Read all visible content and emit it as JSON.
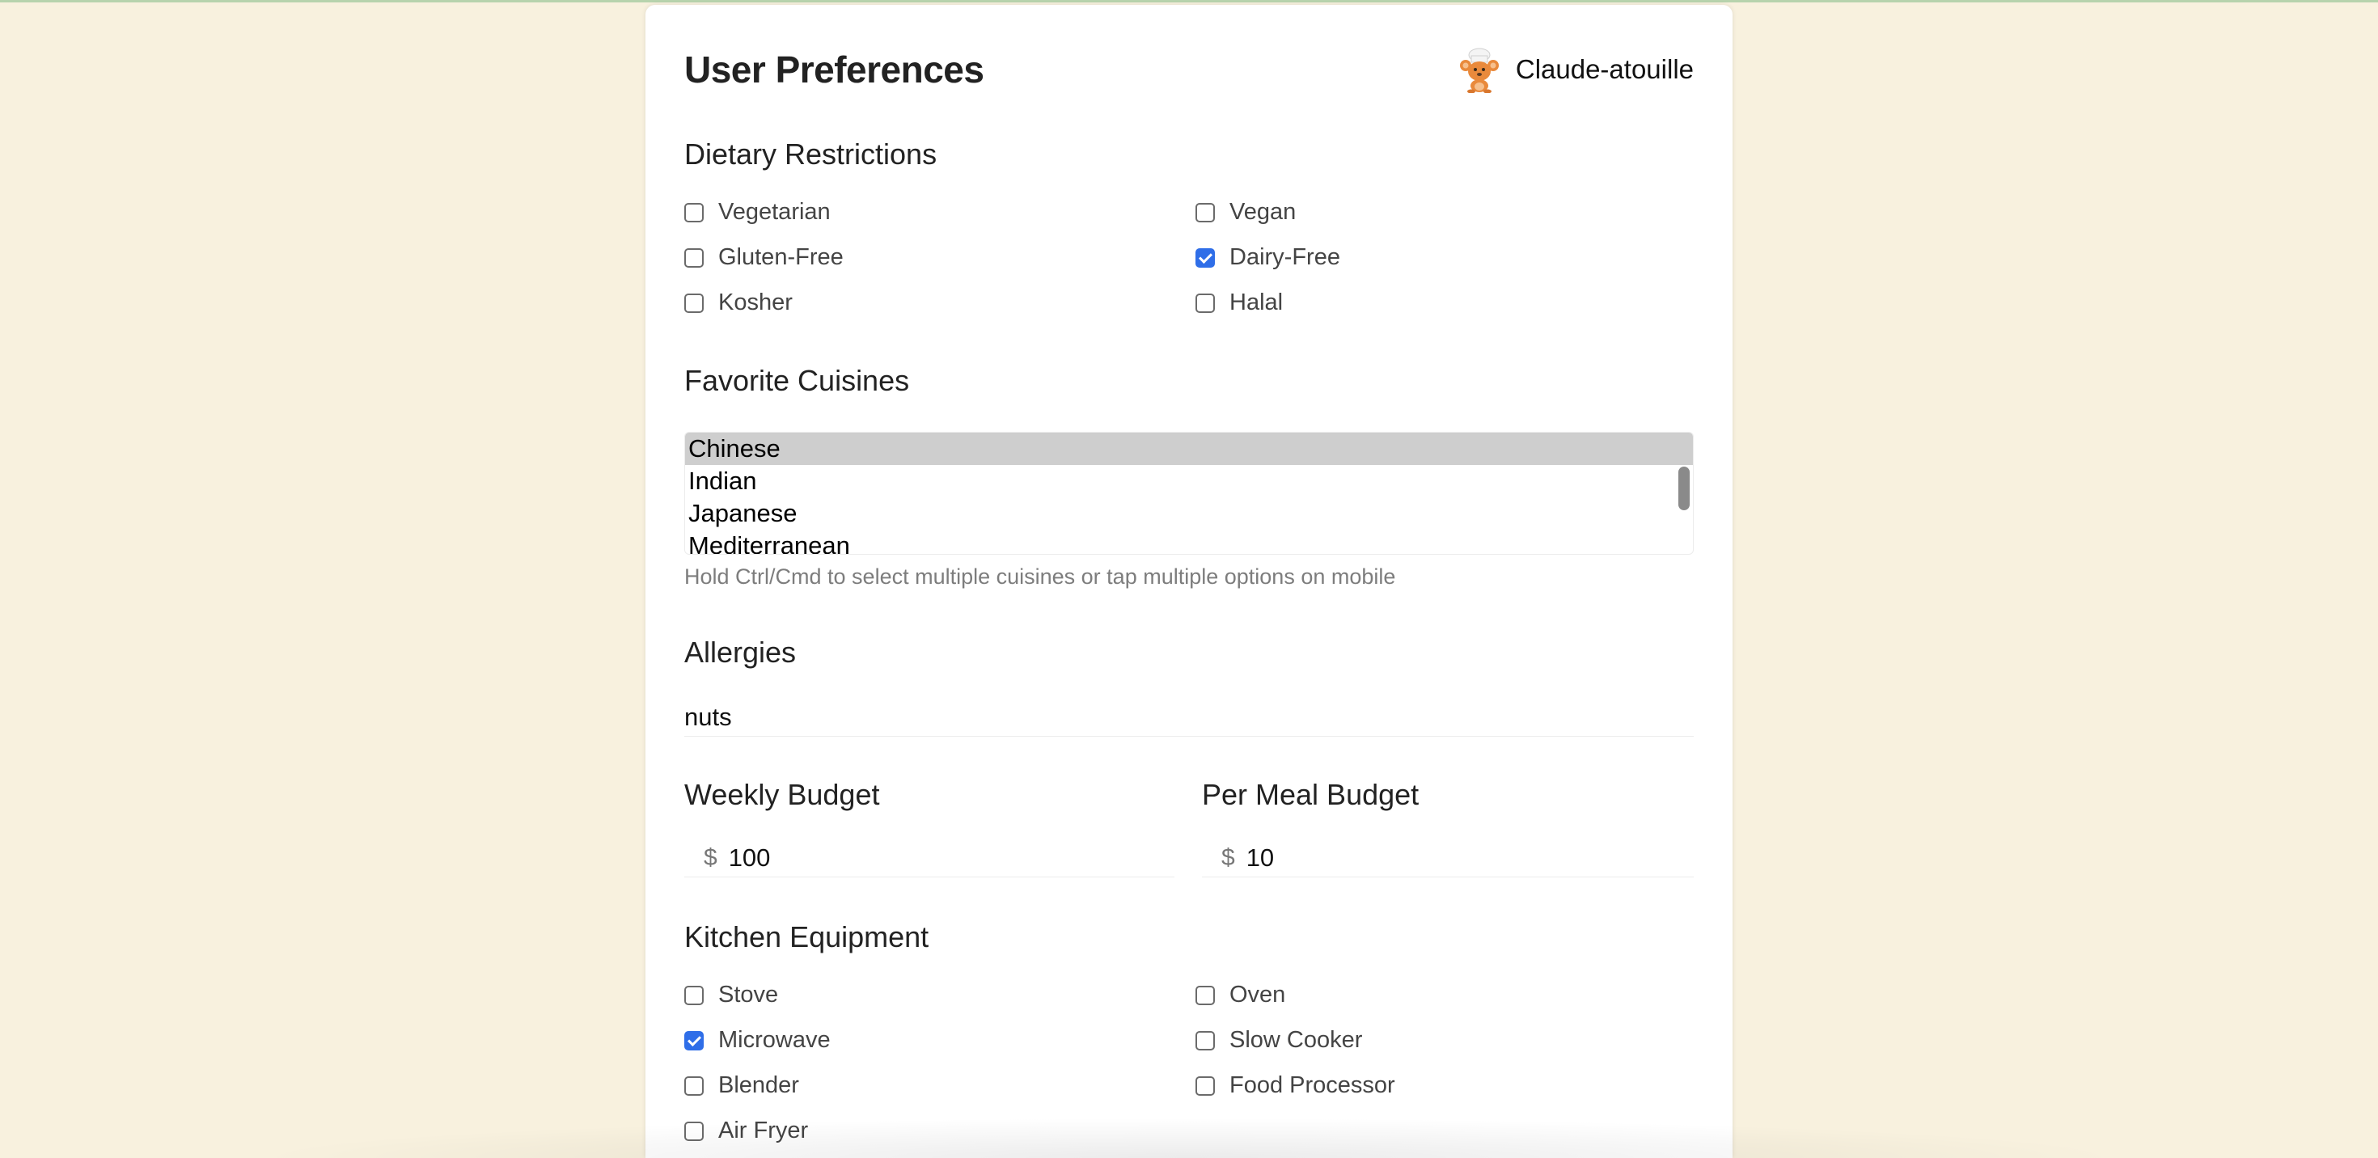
{
  "header": {
    "title": "User Preferences",
    "user_name": "Claude-atouille",
    "avatar_icon": "chef-mouse-avatar"
  },
  "dietary": {
    "title": "Dietary Restrictions",
    "options": [
      {
        "label": "Vegetarian",
        "checked": false
      },
      {
        "label": "Vegan",
        "checked": false
      },
      {
        "label": "Gluten-Free",
        "checked": false
      },
      {
        "label": "Dairy-Free",
        "checked": true
      },
      {
        "label": "Kosher",
        "checked": false
      },
      {
        "label": "Halal",
        "checked": false
      }
    ]
  },
  "cuisines": {
    "title": "Favorite Cuisines",
    "options": [
      "Chinese",
      "Indian",
      "Japanese",
      "Mediterranean"
    ],
    "selected": "Chinese",
    "hint": "Hold Ctrl/Cmd to select multiple cuisines or tap multiple options on mobile"
  },
  "allergies": {
    "title": "Allergies",
    "value": "nuts"
  },
  "weekly_budget": {
    "title": "Weekly Budget",
    "currency": "$",
    "value": "100"
  },
  "per_meal_budget": {
    "title": "Per Meal Budget",
    "currency": "$",
    "value": "10"
  },
  "equipment": {
    "title": "Kitchen Equipment",
    "options": [
      {
        "label": "Stove",
        "checked": false
      },
      {
        "label": "Oven",
        "checked": false
      },
      {
        "label": "Microwave",
        "checked": true
      },
      {
        "label": "Slow Cooker",
        "checked": false
      },
      {
        "label": "Blender",
        "checked": false
      },
      {
        "label": "Food Processor",
        "checked": false
      },
      {
        "label": "Air Fryer",
        "checked": false
      }
    ]
  },
  "colors": {
    "background": "#f8f1de",
    "accent": "#2f6ee8",
    "selected_option": "#cecece"
  }
}
